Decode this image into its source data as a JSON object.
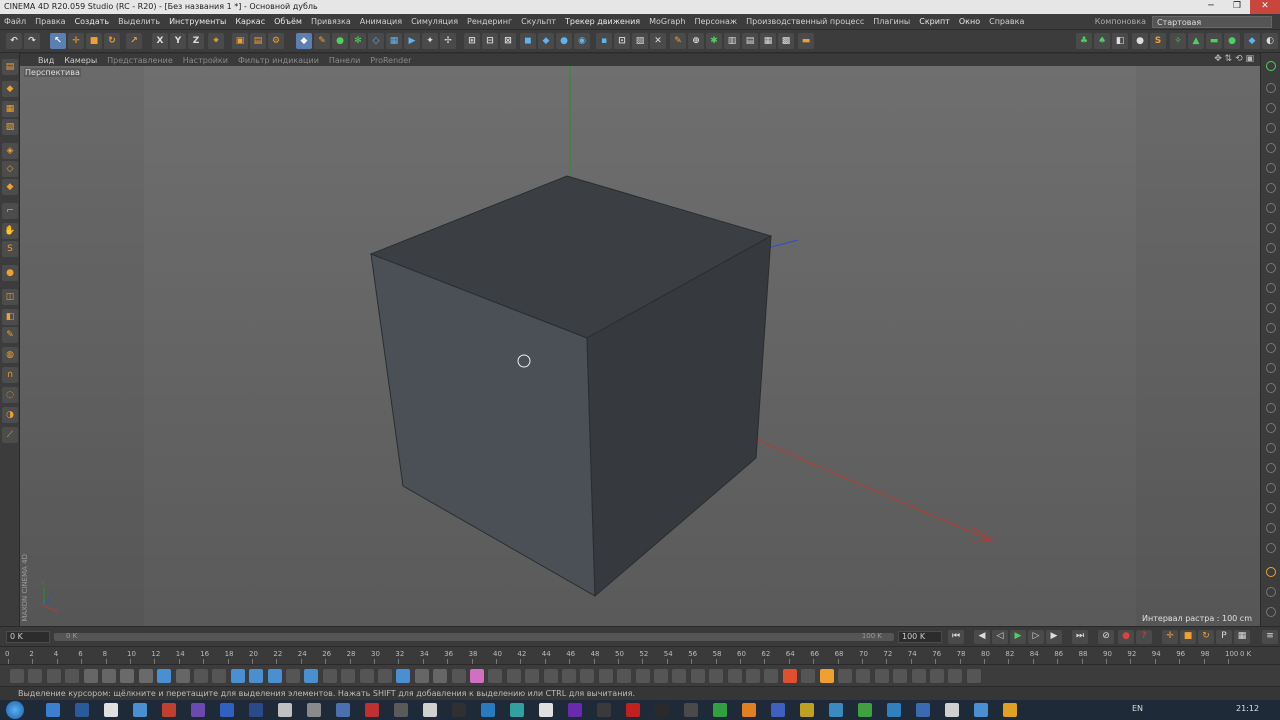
{
  "titlebar": {
    "title": "CINEMA 4D R20.059 Studio (RC - R20) - [Без названия 1 *] - Основной дубль"
  },
  "menubar": {
    "items": [
      "Файл",
      "Правка",
      "Создать",
      "Выделить",
      "Инструменты",
      "Каркас",
      "Объём",
      "Привязка",
      "Анимация",
      "Симуляция",
      "Рендеринг",
      "Скульпт",
      "Трекер движения",
      "MoGraph",
      "Персонаж",
      "Производственный процесс",
      "Плагины",
      "Скрипт",
      "Окно",
      "Справка"
    ],
    "layout_label": "Компоновка",
    "layout_value": "Стартовая (пользователь)"
  },
  "viewport": {
    "menu": [
      "Вид",
      "Камеры",
      "Представление",
      "Настройки",
      "Фильтр индикации",
      "Панели",
      "ProRender"
    ],
    "label": "Перспектива",
    "grid_interval": "Интервал растра : 100 cm",
    "brand": "MAXON CINEMA 4D",
    "axis_x": "X",
    "axis_y": "Y",
    "axis_z": "Z",
    "colors": {
      "cube_top": "#3b3f43",
      "cube_front": "#4a5055",
      "cube_side": "#363a3e",
      "axis_x": "#b83a32",
      "axis_y": "#2c8f2c",
      "axis_z": "#3050c0"
    }
  },
  "timeline": {
    "current": "0 K",
    "slider_start": "0 K",
    "slider_end": "100 K",
    "end_field": "100 K",
    "ticks": [
      "0",
      "2",
      "4",
      "6",
      "8",
      "10",
      "12",
      "14",
      "16",
      "18",
      "20",
      "22",
      "24",
      "26",
      "28",
      "30",
      "32",
      "34",
      "36",
      "38",
      "40",
      "42",
      "44",
      "46",
      "48",
      "50",
      "52",
      "54",
      "56",
      "58",
      "60",
      "62",
      "64",
      "66",
      "68",
      "70",
      "72",
      "74",
      "76",
      "78",
      "80",
      "82",
      "84",
      "86",
      "88",
      "90",
      "92",
      "94",
      "96",
      "98",
      "100"
    ],
    "frame_readout": "0 K"
  },
  "statusbar": {
    "text": "Выделение курсором: щёлкните и перетащите для выделения элементов. Нажать SHIFT для добавления к выделению или CTRL для вычитания."
  },
  "taskbar": {
    "lang": "EN",
    "time": "21:12"
  },
  "window_buttons": {
    "minimize": "─",
    "maximize": "❐",
    "close": "✕"
  }
}
